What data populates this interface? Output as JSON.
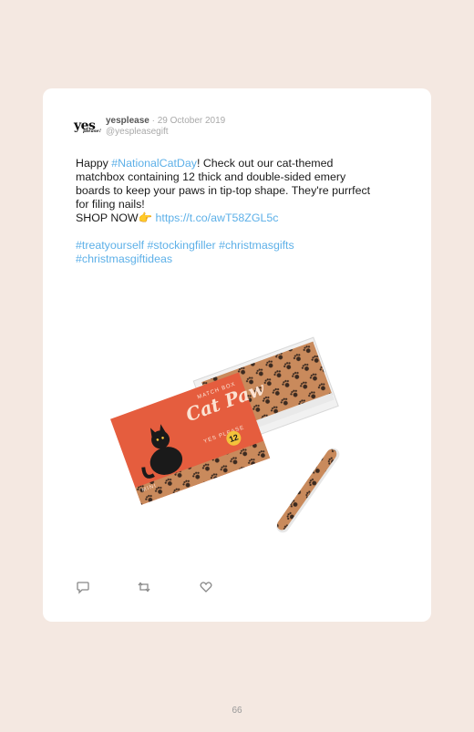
{
  "tweet": {
    "avatar": {
      "line1": "yes",
      "line2": "please!"
    },
    "name": "yesplease",
    "separator": "·",
    "date": "29 October 2019",
    "handle": "@yespleasegift",
    "text": {
      "l1_a": "Happy ",
      "l1_tag": "#NationalCatDay",
      "l1_b": "! Check out our cat-themed",
      "l2": "matchbox containing 12 thick and double-sided emery",
      "l3": "boards to keep your paws in tip-top shape. They're purrfect",
      "l4": "for filing nails!",
      "l5_a": "SHOP NOW",
      "l5_emoji": "👉",
      "l5_link": "https://t.co/awT58ZGL5c",
      "hashtags_1": [
        "#treatyourself",
        "#stockingfiller",
        "#christmasgifts"
      ],
      "hashtags_2": [
        "#christmasgiftideas"
      ]
    },
    "product": {
      "brand": "MATCH BOX",
      "title": "Cat Paw",
      "subtitle": "EMERY BOARDS",
      "badge_left": "MINI",
      "count": "12",
      "stripe": "YES PLEASE"
    },
    "actions": [
      "reply-icon",
      "retweet-icon",
      "like-icon"
    ]
  },
  "page": {
    "number": "66"
  },
  "colors": {
    "background": "#f4e8e1",
    "card": "#ffffff",
    "link": "#5db0e8",
    "box": "#e55d3e"
  }
}
